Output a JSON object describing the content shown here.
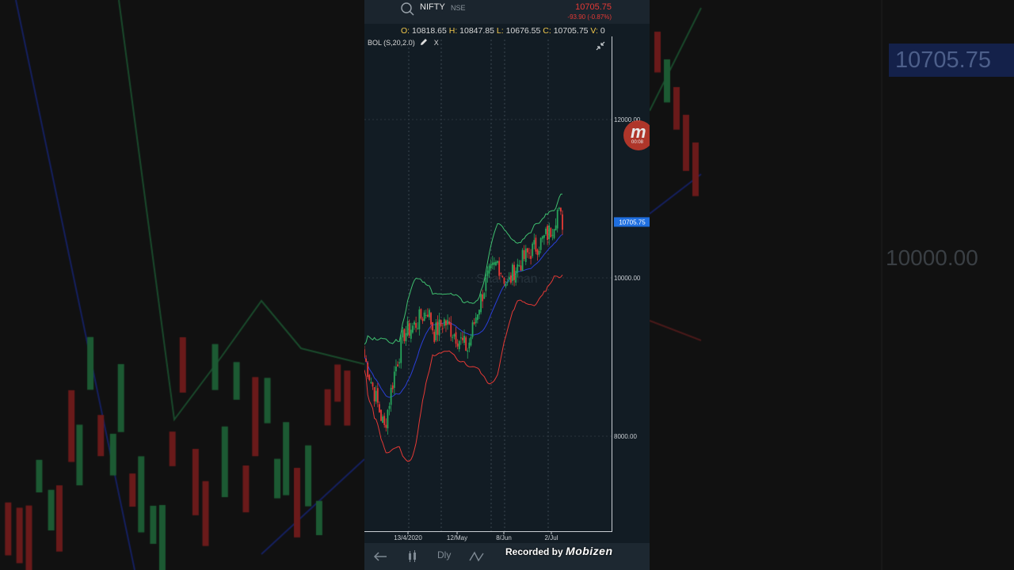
{
  "app": {
    "symbol": "NIFTY",
    "exchange": "NSE",
    "last_price": "10705.75",
    "change": "-93.90 (-0.87%)",
    "ohlc": {
      "o_label": "O:",
      "o": "10818.65",
      "h_label": "H:",
      "h": "10847.85",
      "l_label": "L:",
      "l": "10676.55",
      "c_label": "C:",
      "c": "10705.75",
      "v_label": "V:",
      "v": "0"
    },
    "indicator": {
      "label": "BOL (S,20,2.0)",
      "close": "X"
    },
    "watermark_text": "Sharekhan"
  },
  "chart_data": {
    "type": "candlestick",
    "y_ticks": [
      "12000.00",
      "10000.00",
      "8000.00"
    ],
    "x_ticks": [
      "13/4/2020",
      "12/May",
      "8/Jun",
      "2/Jul"
    ],
    "current_price_label": "10705.75",
    "ylim": [
      6900,
      13000
    ],
    "indicators": [
      "Bollinger upper",
      "Bollinger middle",
      "Bollinger lower"
    ],
    "colors": {
      "up": "#26a65b",
      "down": "#e53935",
      "upper_band": "#3fbf6f",
      "middle_band": "#2a3fd8",
      "lower_band": "#e53935",
      "price_tag": "#1f6fe0"
    }
  },
  "navbar": {
    "back_icon": "arrow-left-icon",
    "candle_icon": "candle-type-icon",
    "period_label": "Dly",
    "study_icon": "indicator-icon"
  },
  "recorder": {
    "prefix": "Recorded by",
    "brand": "Mobizen",
    "badge_letter": "m",
    "badge_time": "00:08"
  },
  "background": {
    "price_label": "10705.75",
    "level_label": "10000.00"
  }
}
